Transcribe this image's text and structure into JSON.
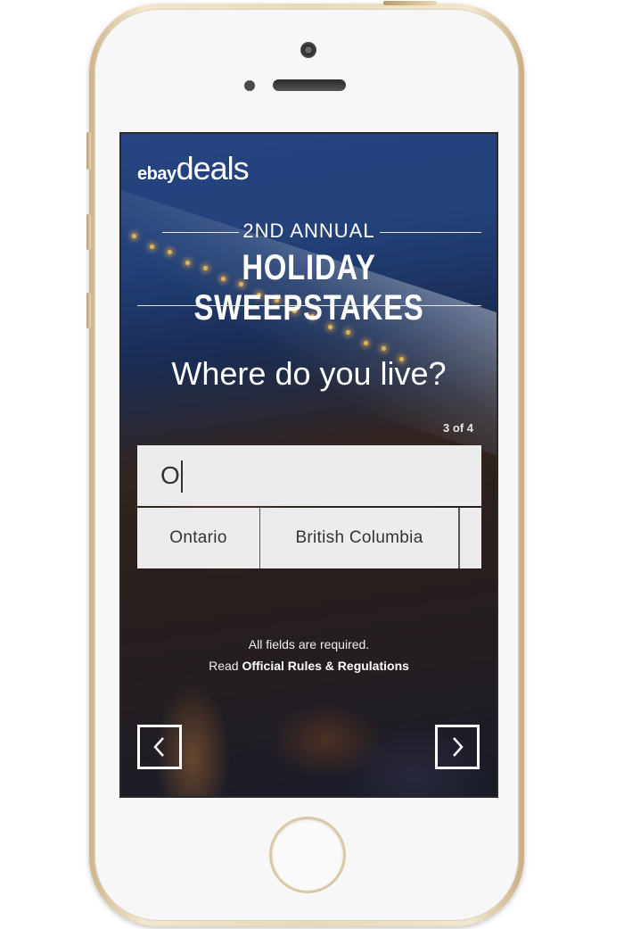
{
  "header": {
    "logo_brand": "ebay",
    "logo_product": "deals",
    "subtitle": "2ND ANNUAL",
    "title": "HOLIDAY SWEEPSTAKES"
  },
  "form": {
    "question": "Where do you live?",
    "step": "3 of 4",
    "input_value": "O"
  },
  "suggestions": [
    {
      "label": "Ontario"
    },
    {
      "label": "British Columbia"
    },
    {
      "label": ""
    }
  ],
  "footer": {
    "required": "All fields are required.",
    "read_prefix": "Read",
    "rules_link": "Official Rules & Regulations"
  },
  "nav": {
    "prev_icon": "chevron-left-icon",
    "next_icon": "chevron-right-icon"
  },
  "colors": {
    "input_bg": "#ececec",
    "text_white": "#ffffff",
    "phone_gold": "#e9d9b8"
  }
}
